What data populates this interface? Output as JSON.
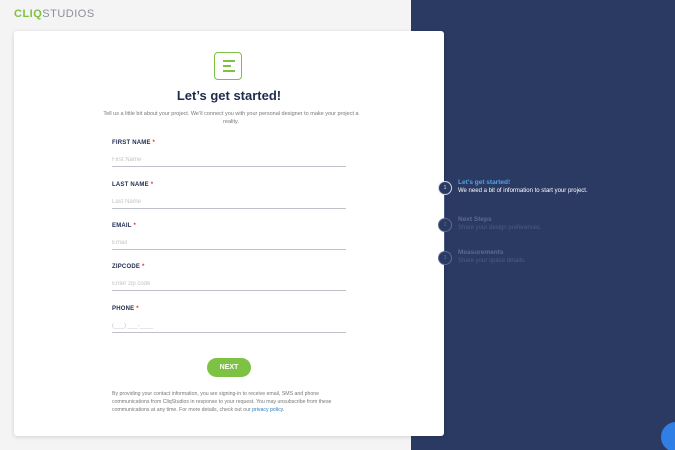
{
  "brand": {
    "logo_prefix": "CLIQ",
    "logo_suffix": "STUDIOS",
    "accent_color": "#7dc242",
    "panel_color": "#2b3a63"
  },
  "form": {
    "icon": "form-document-icon",
    "title": "Let’s get started!",
    "intro": "Tell us a little bit about your project. We’ll connect you with your personal designer to make your project a reality.",
    "fields": [
      {
        "label": "FIRST NAME",
        "required_mark": "*",
        "placeholder": "First Name"
      },
      {
        "label": "LAST NAME",
        "required_mark": "*",
        "placeholder": "Last Name"
      },
      {
        "label": "EMAIL",
        "required_mark": "*",
        "placeholder": "Email"
      },
      {
        "label": "ZIPCODE",
        "required_mark": "*",
        "placeholder": "Enter zip code"
      },
      {
        "label": "PHONE",
        "required_mark": "*",
        "placeholder": "(___) ___-____"
      }
    ],
    "next_label": "NEXT",
    "disclaimer": "By providing your contact information, you are signing-in to receive email, SMS and phone communications from CliqStudios in response to your request. You may unsubscribe from these communications at any time. For more details, check out our",
    "privacy_link": "privacy policy."
  },
  "steps": [
    {
      "number": "1",
      "title": "Let’s get started!",
      "description": "We need a bit of information to start your project."
    },
    {
      "number": "2",
      "title": "Next Steps",
      "description": "Share your design preferences."
    },
    {
      "number": "3",
      "title": "Measurements",
      "description": "Share your space details."
    }
  ]
}
